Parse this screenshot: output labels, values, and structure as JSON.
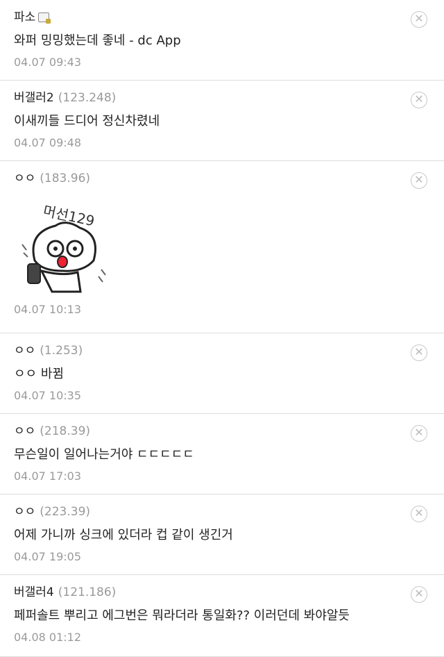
{
  "comments": [
    {
      "nick": "파소",
      "ip": "",
      "badge": true,
      "text": "와퍼 밍밍했는데 좋네 - dc App",
      "date": "04.07 09:43"
    },
    {
      "nick": "버갤러2",
      "ip": "(123.248)",
      "text": "이새끼들 드디어 정신차렸네",
      "date": "04.07 09:48"
    },
    {
      "nick": "ㅇㅇ",
      "ip": "(183.96)",
      "sticker": {
        "label": "머선129"
      },
      "date": "04.07 10:13"
    },
    {
      "nick": "ㅇㅇ",
      "ip": "(1.253)",
      "text": "ㅇㅇ 바뀜",
      "date": "04.07 10:35"
    },
    {
      "nick": "ㅇㅇ",
      "ip": "(218.39)",
      "text": "무슨일이 일어나는거야 ㄷㄷㄷㄷㄷ",
      "date": "04.07 17:03"
    },
    {
      "nick": "ㅇㅇ",
      "ip": "(223.39)",
      "text": "어제 가니까 싱크에 있더라 컵 같이 생긴거",
      "date": "04.07 19:05"
    },
    {
      "nick": "버갤러4",
      "ip": "(121.186)",
      "text": "페퍼솔트 뿌리고 에그번은 뭐라더라 통일화?? 이러던데 봐야알듯",
      "date": "04.08 01:12"
    }
  ],
  "icons": {
    "delete": "close-circle-icon",
    "badge": "gallery-badge-icon"
  },
  "colors": {
    "meta": "#999999",
    "divider": "#dcdcdc"
  }
}
